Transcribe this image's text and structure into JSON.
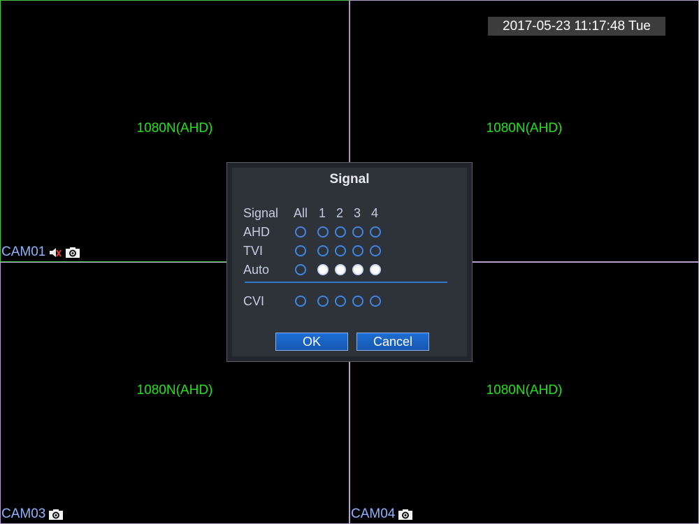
{
  "clock": {
    "text": "2017-05-23 11:17:48 Tue"
  },
  "panes": [
    {
      "resolution": "1080N(AHD)",
      "camera": "CAM01",
      "icons": [
        "speaker-muted-icon",
        "camera-record-icon"
      ]
    },
    {
      "resolution": "1080N(AHD)",
      "camera": "",
      "icons": []
    },
    {
      "resolution": "1080N(AHD)",
      "camera": "CAM03",
      "icons": [
        "camera-record-icon"
      ]
    },
    {
      "resolution": "1080N(AHD)",
      "camera": "CAM04",
      "icons": [
        "camera-record-icon"
      ]
    }
  ],
  "dialog": {
    "title": "Signal",
    "header": {
      "label": "Signal",
      "all": "All",
      "channels": [
        "1",
        "2",
        "3",
        "4"
      ]
    },
    "rows": [
      {
        "label": "AHD",
        "all": false,
        "channels": [
          false,
          false,
          false,
          false
        ]
      },
      {
        "label": "TVI",
        "all": false,
        "channels": [
          false,
          false,
          false,
          false
        ]
      },
      {
        "label": "Auto",
        "all": false,
        "channels": [
          true,
          true,
          true,
          true
        ]
      },
      {
        "label": "CVI",
        "all": false,
        "channels": [
          false,
          false,
          false,
          false
        ]
      }
    ],
    "ok_label": "OK",
    "cancel_label": "Cancel"
  },
  "colors": {
    "resolution_text": "#21e21a",
    "camera_label": "#8fb3ff",
    "active_pane_border": "#4ac24a",
    "pane_border": "#b79fd0",
    "radio_ring": "#3f86e0",
    "button_blue": "#1f6fd6"
  }
}
